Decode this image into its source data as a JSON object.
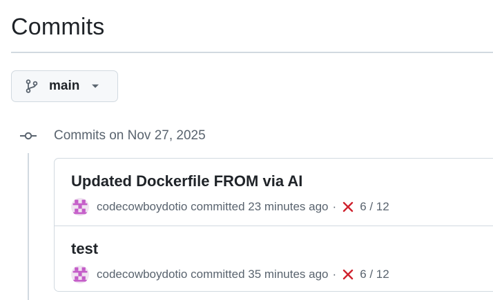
{
  "page": {
    "title": "Commits"
  },
  "branch": {
    "label": "main",
    "icon": "git-branch-icon"
  },
  "commit_group": {
    "heading": "Commits on Nov 27, 2025",
    "icon": "git-commit-icon"
  },
  "commits": [
    {
      "title": "Updated Dockerfile FROM via AI",
      "author": "codecowboydotio",
      "action": "committed",
      "time": "23 minutes ago",
      "separator": "·",
      "status": "failure",
      "status_icon": "x-icon",
      "checks": "6 / 12"
    },
    {
      "title": "test",
      "author": "codecowboydotio",
      "action": "committed",
      "time": "35 minutes ago",
      "separator": "·",
      "status": "failure",
      "status_icon": "x-icon",
      "checks": "6 / 12"
    }
  ],
  "colors": {
    "failure": "#cf222e",
    "avatar": "#c45cc8",
    "muted_text": "#59636e",
    "border": "#d1d9e0"
  }
}
